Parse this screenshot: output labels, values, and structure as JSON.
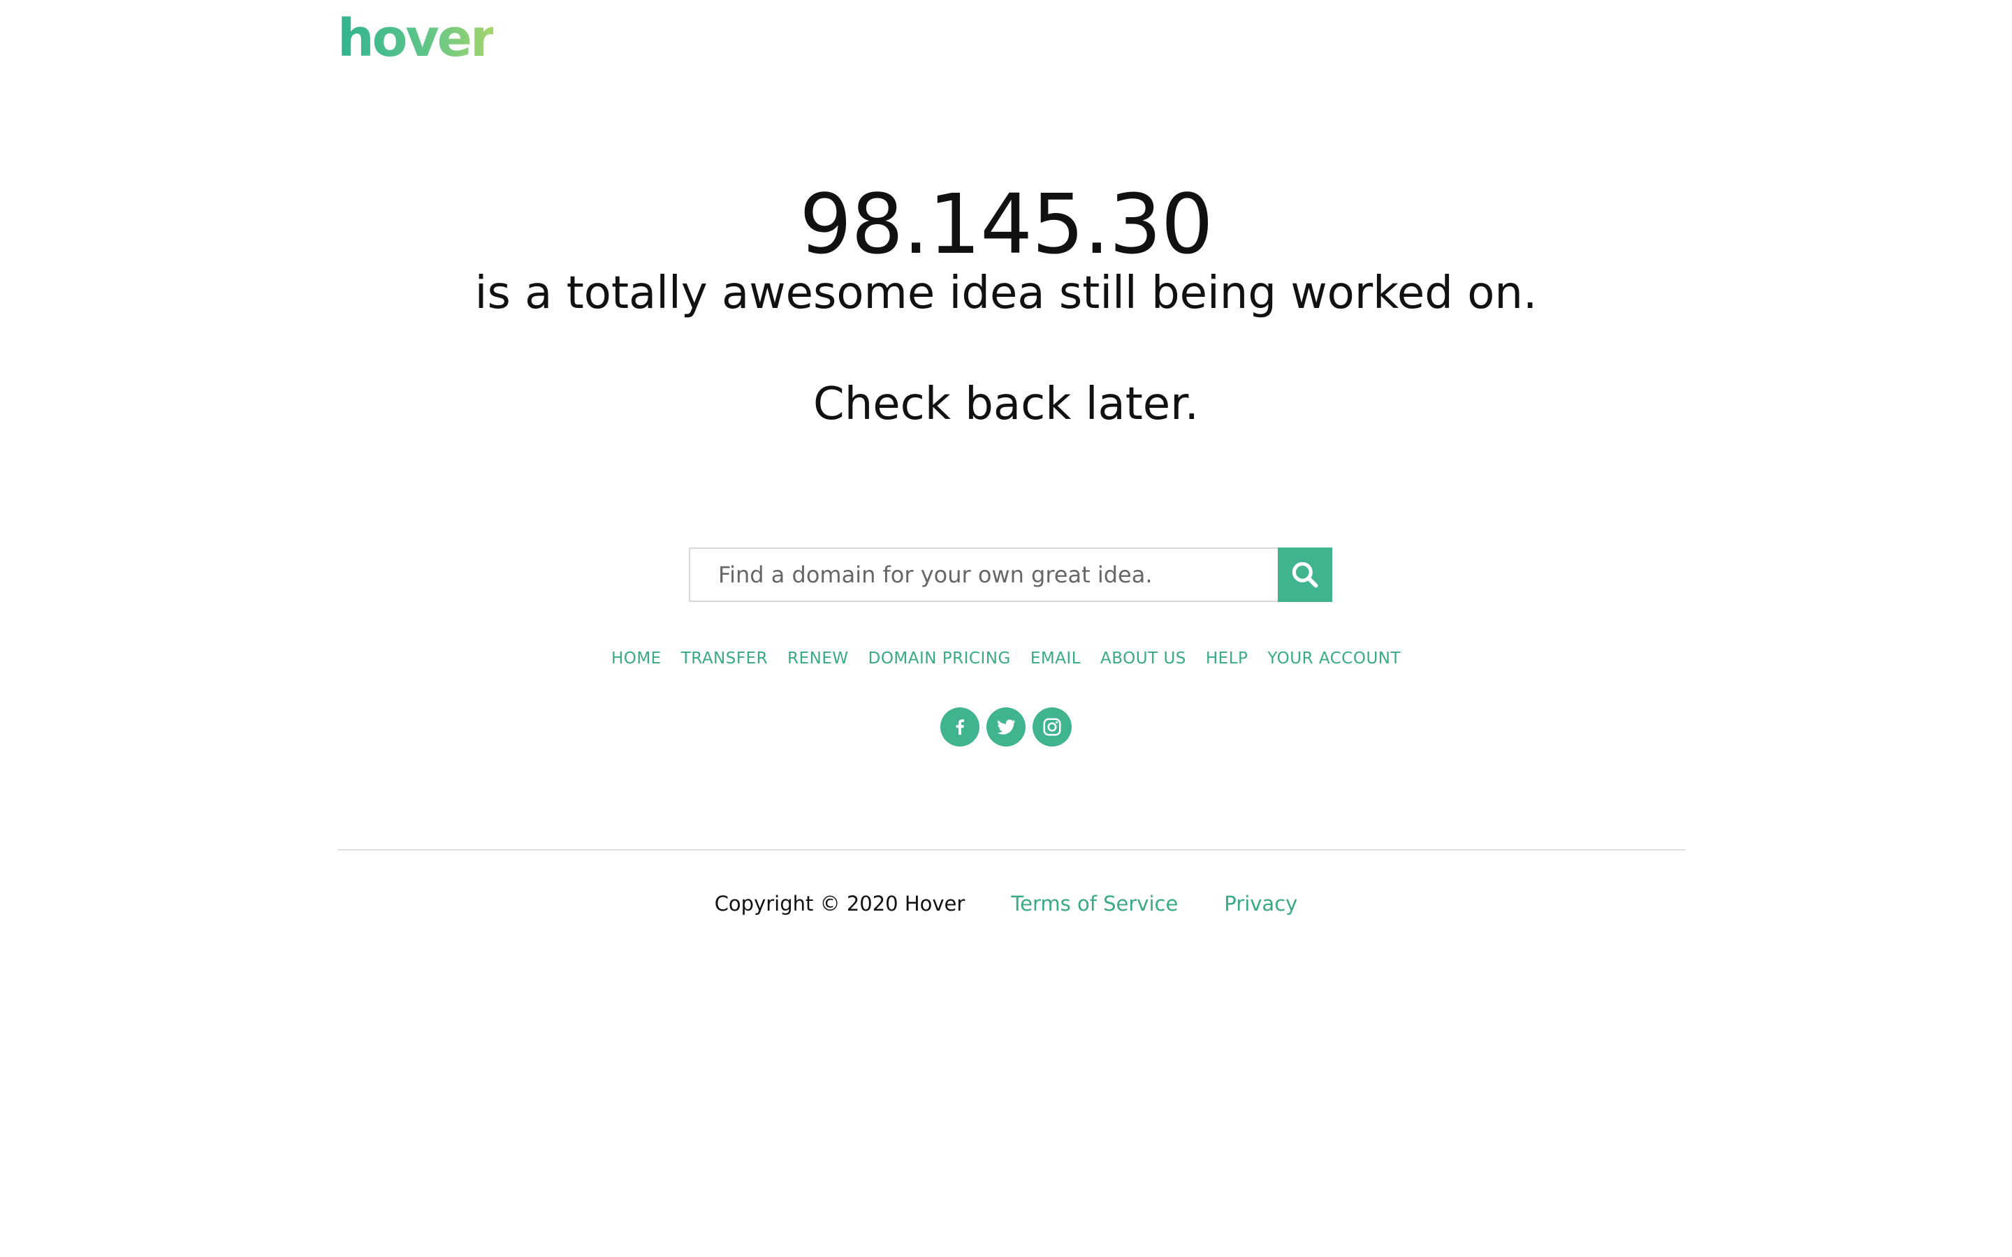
{
  "brand": {
    "logo_text": "hover",
    "accent_color": "#3fb48f",
    "link_color": "#3aa986"
  },
  "hero": {
    "domain": "98.145.30",
    "tagline": "is a totally awesome idea still being worked on.",
    "check_back": "Check back later."
  },
  "search": {
    "placeholder": "Find a domain for your own great idea.",
    "value": "",
    "button_icon": "search-icon"
  },
  "nav": {
    "items": [
      {
        "label": "HOME"
      },
      {
        "label": "TRANSFER"
      },
      {
        "label": "RENEW"
      },
      {
        "label": "DOMAIN PRICING"
      },
      {
        "label": "EMAIL"
      },
      {
        "label": "ABOUT US"
      },
      {
        "label": "HELP"
      },
      {
        "label": "YOUR ACCOUNT"
      }
    ]
  },
  "social": {
    "icons": [
      "facebook-icon",
      "twitter-icon",
      "instagram-icon"
    ]
  },
  "footer": {
    "copyright": "Copyright © 2020 Hover",
    "terms": "Terms of Service",
    "privacy": "Privacy"
  }
}
